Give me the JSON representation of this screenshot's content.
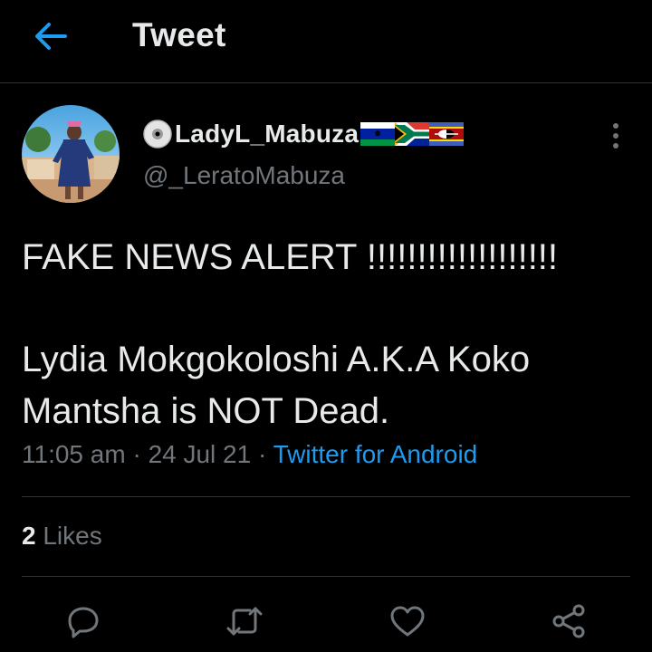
{
  "header": {
    "title": "Tweet",
    "back_icon": "arrow-left-icon"
  },
  "colors": {
    "accent": "#1d9bf0",
    "text": "#e7e9ea",
    "muted": "#71767b",
    "divider": "#2f3336",
    "background": "#000000"
  },
  "author": {
    "display_name": "LadyL_Mabuza",
    "handle": "@_LeratoMabuza",
    "name_prefix_icon": "cd-disc-icon",
    "flags": [
      "flag-lesotho-icon",
      "flag-south-africa-icon",
      "flag-eswatini-icon"
    ]
  },
  "tweet": {
    "line1": "FAKE NEWS ALERT !!!!!!!!!!!!!!!!!!!",
    "line2": "Lydia Mokgokoloshi  A.K.A Koko Mantsha is NOT Dead.",
    "time": "11:05 am",
    "date": "24 Jul 21",
    "separator": " · ",
    "source": "Twitter for Android"
  },
  "stats": {
    "likes_count": "2",
    "likes_label": "Likes"
  },
  "actions": [
    "reply-icon",
    "retweet-icon",
    "like-icon",
    "share-icon"
  ]
}
